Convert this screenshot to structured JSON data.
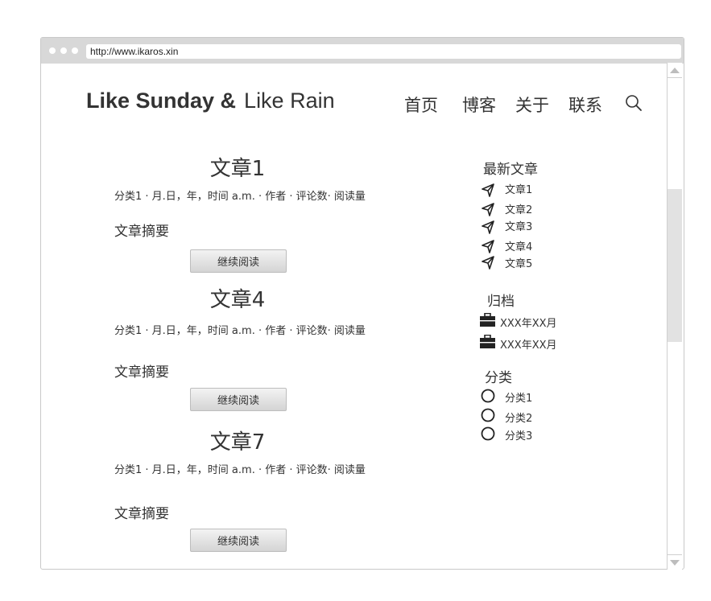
{
  "browser": {
    "url": "http://www.ikaros.xin"
  },
  "header": {
    "logo_bold": "Like Sunday &",
    "logo_thin": "Like Rain",
    "nav": [
      "首页",
      "博客",
      "关于",
      "联系"
    ]
  },
  "articles": [
    {
      "title": "文章1",
      "meta": "分类1 · 月.日，年，时间 a.m. · 作者 · 评论数· 阅读量",
      "summary": "文章摘要",
      "button": "继续阅读"
    },
    {
      "title": "文章4",
      "meta": "分类1 · 月.日，年，时间 a.m. · 作者 · 评论数· 阅读量",
      "summary": "文章摘要",
      "button": "继续阅读"
    },
    {
      "title": "文章7",
      "meta": "分类1 · 月.日，年，时间 a.m. · 作者 · 评论数· 阅读量",
      "summary": "文章摘要",
      "button": "继续阅读"
    }
  ],
  "sidebar": {
    "recent": {
      "title": "最新文章",
      "items": [
        "文章1",
        "文章2",
        "文章3",
        "文章4",
        "文章5"
      ],
      "icon": "send-arrow-icon"
    },
    "archive": {
      "title": "归档",
      "items": [
        "XXX年XX月",
        "XXX年XX月"
      ],
      "icon": "briefcase-icon"
    },
    "categories": {
      "title": "分类",
      "items": [
        "分类1",
        "分类2",
        "分类3"
      ],
      "icon": "circle-icon"
    }
  }
}
